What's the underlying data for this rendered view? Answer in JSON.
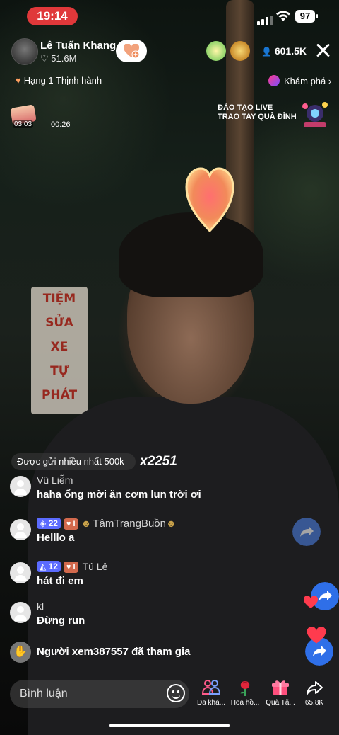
{
  "status_bar": {
    "time": "19:14",
    "battery": "97"
  },
  "host": {
    "name": "Lê Tuấn Khang",
    "likes": "51.6M"
  },
  "viewer_count": "601.5K",
  "top_badges": [
    "gift-ranking-badge",
    "4k-badge"
  ],
  "rank": {
    "label": "Hạng 1 Thịnh hành"
  },
  "explore": {
    "label": "Khám phá"
  },
  "treasure": {
    "countdown": "03:03",
    "timer": "00:26"
  },
  "promo": {
    "line1": "ĐÀO TẠO LIVE",
    "line2": "TRAO TAY QUÀ ĐỈNH"
  },
  "background_sign": [
    "TIỆM",
    "SỬA",
    "XE",
    "TỰ",
    "PHÁT"
  ],
  "gift_banner": {
    "text": "Được gửi nhiều nhất 500k",
    "combo": "x2251"
  },
  "comments": [
    {
      "user": "Vũ Liễm",
      "text": "haha ổng mời ăn cơm lun trời ơi",
      "level": "",
      "fan_badge": ""
    },
    {
      "user": "TâmTrạngBuồn",
      "text": "Helllo a",
      "level": "22",
      "fan_badge": "I"
    },
    {
      "user": "Tú Lê",
      "text": "hát đi em",
      "level": "12",
      "fan_badge": "I"
    },
    {
      "user": "kl",
      "text": "Đừng run",
      "level": "",
      "fan_badge": ""
    }
  ],
  "join_notice": "Người xem387557 đã tham gia",
  "bottom_bar": {
    "comment_placeholder": "Bình luận",
    "actions": [
      {
        "icon": "multi-guest-icon",
        "label": "Đa khá..."
      },
      {
        "icon": "rose-icon",
        "label": "Hoa hồ..."
      },
      {
        "icon": "gift-icon",
        "label": "Quà Tặ..."
      },
      {
        "icon": "share-icon",
        "label": "65.8K"
      }
    ]
  },
  "colors": {
    "accent_red": "#e0383a",
    "level_blue": "#5b6bff",
    "fan_orange": "#d2694d",
    "share_blue": "#2f6fe8"
  }
}
